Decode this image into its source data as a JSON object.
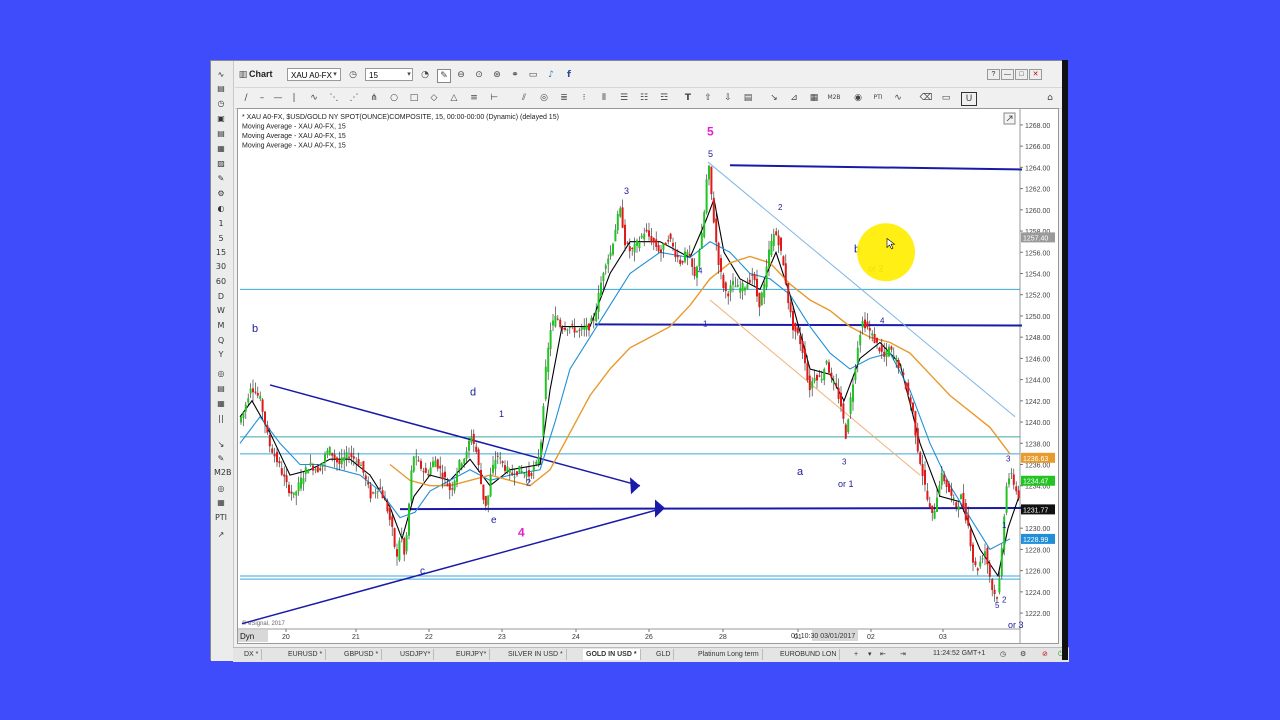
{
  "window": {
    "title": "Chart",
    "symbol": "XAU A0-FX",
    "interval": "15",
    "winbuttons": [
      "?",
      "—",
      "□",
      "✕"
    ]
  },
  "left_tools": [
    "∿",
    "▤",
    "◷",
    "▣",
    "▤",
    "▦",
    "▨",
    "✎",
    "⚙",
    "◐",
    "1",
    "5",
    "15",
    "30",
    "60",
    "D",
    "W",
    "M",
    "Q",
    "Y",
    "◎",
    "▤",
    "▦",
    "||",
    "↘",
    "✎",
    "M2B",
    "◎",
    "▦",
    "PTI",
    "↗"
  ],
  "chart_info": {
    "line1": "* XAU A0-FX, $USD/GOLD NY SPOT(OUNCE)COMPOSITE, 15, 00:00-00:00 (Dynamic) (delayed 15)",
    "line2": "Moving Average - XAU A0-FX, 15",
    "line3": "Moving Average - XAU A0-FX, 15",
    "line4": "Moving Average - XAU A0-FX, 15",
    "copyright": "© eSignal, 2017",
    "dyn": "Dyn",
    "cursor_date": "01 10:30 03/01/2017"
  },
  "colors": {
    "background": "#3f4cfb",
    "price_up": "#22c322",
    "price_down": "#e01a1a",
    "ma_fast": "#000000",
    "ma_mid": "#1f8fd8",
    "ma_slow": "#e89a2c",
    "drawn_lines": "#1a1aaa",
    "wave_label": "#1a1a9c",
    "magenta": "#e020d0",
    "highlight": "#ffee00"
  },
  "chart_data": {
    "type": "candlestick",
    "x_tick_labels": [
      "20",
      "21",
      "22",
      "23",
      "24",
      "26",
      "28",
      "01",
      "02",
      "03"
    ],
    "y_ticks": [
      1222,
      1224,
      1226,
      1228,
      1230,
      1232,
      1234,
      1236,
      1238,
      1240,
      1242,
      1244,
      1246,
      1248,
      1250,
      1252,
      1254,
      1256,
      1258,
      1260,
      1262,
      1264,
      1266,
      1268
    ],
    "ylim": [
      1220.5,
      1269.5
    ],
    "price_tags": [
      {
        "value": 1257.4,
        "label": "1257.40",
        "color": "#9a9a9a"
      },
      {
        "value": 1236.63,
        "label": "1236.63",
        "color": "#e89a2c"
      },
      {
        "value": 1234.47,
        "label": "1234.47",
        "color": "#22c322"
      },
      {
        "value": 1231.77,
        "label": "1231.77",
        "color": "#111111"
      },
      {
        "value": 1228.99,
        "label": "1228.99",
        "color": "#1f8fd8"
      }
    ],
    "price_path": [
      [
        0,
        1240
      ],
      [
        5,
        1241
      ],
      [
        12,
        1243.5
      ],
      [
        22,
        1242
      ],
      [
        30,
        1238
      ],
      [
        40,
        1236
      ],
      [
        48,
        1234
      ],
      [
        55,
        1233
      ],
      [
        62,
        1234.5
      ],
      [
        70,
        1236
      ],
      [
        80,
        1235.5
      ],
      [
        90,
        1237.5
      ],
      [
        100,
        1236
      ],
      [
        110,
        1237
      ],
      [
        122,
        1236
      ],
      [
        132,
        1233
      ],
      [
        140,
        1234
      ],
      [
        148,
        1232
      ],
      [
        153,
        1230
      ],
      [
        158,
        1227
      ],
      [
        162,
        1230
      ],
      [
        166,
        1227
      ],
      [
        170,
        1232
      ],
      [
        174,
        1237
      ],
      [
        180,
        1236
      ],
      [
        188,
        1235
      ],
      [
        196,
        1236.5
      ],
      [
        204,
        1235
      ],
      [
        212,
        1233.5
      ],
      [
        220,
        1236
      ],
      [
        228,
        1237
      ],
      [
        232,
        1239
      ],
      [
        238,
        1237
      ],
      [
        244,
        1233
      ],
      [
        248,
        1232
      ],
      [
        252,
        1235
      ],
      [
        258,
        1237
      ],
      [
        264,
        1236
      ],
      [
        272,
        1235
      ],
      [
        280,
        1235.5
      ],
      [
        290,
        1235
      ],
      [
        298,
        1236
      ],
      [
        302,
        1238
      ],
      [
        306,
        1244
      ],
      [
        312,
        1249
      ],
      [
        318,
        1250
      ],
      [
        322,
        1249
      ],
      [
        330,
        1249
      ],
      [
        340,
        1248.5
      ],
      [
        350,
        1249
      ],
      [
        356,
        1250
      ],
      [
        360,
        1252
      ],
      [
        366,
        1255
      ],
      [
        372,
        1256
      ],
      [
        378,
        1259
      ],
      [
        382,
        1260
      ],
      [
        386,
        1257
      ],
      [
        392,
        1256
      ],
      [
        400,
        1257
      ],
      [
        406,
        1258
      ],
      [
        414,
        1257
      ],
      [
        422,
        1256
      ],
      [
        430,
        1257.5
      ],
      [
        436,
        1256
      ],
      [
        442,
        1255
      ],
      [
        448,
        1256
      ],
      [
        452,
        1255
      ],
      [
        456,
        1253.5
      ],
      [
        460,
        1256
      ],
      [
        464,
        1258
      ],
      [
        468,
        1263
      ],
      [
        470,
        1264
      ],
      [
        472,
        1262
      ],
      [
        476,
        1258
      ],
      [
        480,
        1255
      ],
      [
        484,
        1253
      ],
      [
        488,
        1252
      ],
      [
        494,
        1253
      ],
      [
        500,
        1252.5
      ],
      [
        508,
        1253
      ],
      [
        514,
        1254
      ],
      [
        520,
        1251
      ],
      [
        526,
        1253
      ],
      [
        530,
        1256
      ],
      [
        536,
        1258
      ],
      [
        540,
        1257
      ],
      [
        546,
        1254
      ],
      [
        550,
        1251
      ],
      [
        554,
        1249
      ],
      [
        560,
        1248
      ],
      [
        566,
        1246
      ],
      [
        570,
        1243
      ],
      [
        576,
        1244.5
      ],
      [
        582,
        1244
      ],
      [
        588,
        1246
      ],
      [
        592,
        1244
      ],
      [
        598,
        1243
      ],
      [
        604,
        1241
      ],
      [
        606,
        1238
      ],
      [
        610,
        1241
      ],
      [
        616,
        1245
      ],
      [
        620,
        1248
      ],
      [
        624,
        1249.5
      ],
      [
        628,
        1249
      ],
      [
        634,
        1248
      ],
      [
        640,
        1247
      ],
      [
        646,
        1246
      ],
      [
        650,
        1247
      ],
      [
        656,
        1246
      ],
      [
        662,
        1245
      ],
      [
        668,
        1243
      ],
      [
        674,
        1241
      ],
      [
        678,
        1238
      ],
      [
        682,
        1236
      ],
      [
        686,
        1234
      ],
      [
        690,
        1232
      ],
      [
        694,
        1231
      ],
      [
        698,
        1233
      ],
      [
        702,
        1235
      ],
      [
        706,
        1234.5
      ],
      [
        712,
        1233
      ],
      [
        718,
        1232
      ],
      [
        722,
        1233
      ],
      [
        726,
        1231.5
      ],
      [
        730,
        1230
      ],
      [
        734,
        1227
      ],
      [
        738,
        1226
      ],
      [
        742,
        1227
      ],
      [
        746,
        1228
      ],
      [
        750,
        1226
      ],
      [
        754,
        1224
      ],
      [
        758,
        1223.5
      ],
      [
        762,
        1226
      ],
      [
        764,
        1230
      ],
      [
        766,
        1232
      ],
      [
        768,
        1234.5
      ],
      [
        772,
        1235
      ],
      [
        776,
        1234
      ],
      [
        779,
        1233
      ]
    ],
    "moving_averages": [
      {
        "name": "Moving Average - XAU A0-FX, 15",
        "color": "#000000",
        "points": [
          [
            0,
            1240.5
          ],
          [
            12,
            1242
          ],
          [
            30,
            1239
          ],
          [
            50,
            1235
          ],
          [
            70,
            1235.5
          ],
          [
            90,
            1236.5
          ],
          [
            110,
            1236.5
          ],
          [
            130,
            1235
          ],
          [
            150,
            1232
          ],
          [
            162,
            1229
          ],
          [
            174,
            1233
          ],
          [
            190,
            1235
          ],
          [
            210,
            1234.5
          ],
          [
            230,
            1236.5
          ],
          [
            250,
            1234
          ],
          [
            270,
            1235.5
          ],
          [
            300,
            1236
          ],
          [
            310,
            1243
          ],
          [
            322,
            1249
          ],
          [
            350,
            1249
          ],
          [
            370,
            1254
          ],
          [
            390,
            1257
          ],
          [
            420,
            1257
          ],
          [
            450,
            1255.5
          ],
          [
            466,
            1259
          ],
          [
            474,
            1261
          ],
          [
            484,
            1256
          ],
          [
            500,
            1253.5
          ],
          [
            520,
            1252.5
          ],
          [
            536,
            1256
          ],
          [
            550,
            1252
          ],
          [
            570,
            1245
          ],
          [
            590,
            1244.5
          ],
          [
            604,
            1242
          ],
          [
            620,
            1246
          ],
          [
            640,
            1247.5
          ],
          [
            660,
            1245.5
          ],
          [
            680,
            1238
          ],
          [
            700,
            1233
          ],
          [
            720,
            1232.5
          ],
          [
            740,
            1228
          ],
          [
            758,
            1225.5
          ],
          [
            768,
            1230
          ],
          [
            779,
            1233
          ]
        ]
      },
      {
        "name": "Moving Average - XAU A0-FX, 15",
        "color": "#1f8fd8",
        "points": [
          [
            0,
            1238
          ],
          [
            20,
            1240.5
          ],
          [
            40,
            1238
          ],
          [
            60,
            1236
          ],
          [
            80,
            1236
          ],
          [
            100,
            1235.5
          ],
          [
            120,
            1235
          ],
          [
            140,
            1233.5
          ],
          [
            160,
            1231
          ],
          [
            175,
            1231.5
          ],
          [
            190,
            1233.5
          ],
          [
            210,
            1234.5
          ],
          [
            230,
            1235.5
          ],
          [
            250,
            1234.5
          ],
          [
            270,
            1235
          ],
          [
            300,
            1235.5
          ],
          [
            315,
            1240
          ],
          [
            330,
            1245
          ],
          [
            350,
            1248
          ],
          [
            370,
            1251
          ],
          [
            390,
            1254
          ],
          [
            420,
            1256
          ],
          [
            450,
            1255.5
          ],
          [
            470,
            1257
          ],
          [
            490,
            1256
          ],
          [
            510,
            1254
          ],
          [
            530,
            1253.5
          ],
          [
            550,
            1252
          ],
          [
            570,
            1249
          ],
          [
            590,
            1246.5
          ],
          [
            610,
            1245
          ],
          [
            630,
            1246
          ],
          [
            650,
            1246.5
          ],
          [
            670,
            1243
          ],
          [
            690,
            1238
          ],
          [
            710,
            1234
          ],
          [
            730,
            1231
          ],
          [
            750,
            1228
          ],
          [
            770,
            1229
          ]
        ]
      },
      {
        "name": "Moving Average - XAU A0-FX, 15",
        "color": "#e89a2c",
        "points": [
          [
            150,
            1236
          ],
          [
            170,
            1234.5
          ],
          [
            190,
            1234
          ],
          [
            210,
            1234
          ],
          [
            230,
            1234.5
          ],
          [
            250,
            1235
          ],
          [
            270,
            1234.5
          ],
          [
            290,
            1234
          ],
          [
            310,
            1235.5
          ],
          [
            330,
            1239
          ],
          [
            350,
            1242.5
          ],
          [
            370,
            1245
          ],
          [
            390,
            1247
          ],
          [
            410,
            1248
          ],
          [
            430,
            1249
          ],
          [
            450,
            1251
          ],
          [
            470,
            1253.5
          ],
          [
            490,
            1255
          ],
          [
            510,
            1255.6
          ],
          [
            530,
            1255
          ],
          [
            550,
            1253
          ],
          [
            570,
            1251.5
          ],
          [
            590,
            1250.5
          ],
          [
            610,
            1249
          ],
          [
            630,
            1248
          ],
          [
            650,
            1247.5
          ],
          [
            670,
            1246.5
          ],
          [
            690,
            1244.5
          ],
          [
            710,
            1242.5
          ],
          [
            730,
            1241
          ],
          [
            750,
            1239.5
          ],
          [
            770,
            1237
          ]
        ]
      }
    ],
    "annotations": [
      {
        "text": "5",
        "x": 467,
        "v": 1267,
        "color": "#e020d0",
        "size": 12
      },
      {
        "text": "5",
        "x": 468,
        "v": 1265,
        "color": "#1a1a9c",
        "size": 9
      },
      {
        "text": "3",
        "x": 384,
        "v": 1261.5,
        "color": "#1a1a9c",
        "size": 9
      },
      {
        "text": "2",
        "x": 538,
        "v": 1260,
        "color": "#1a1a9c",
        "size": 8
      },
      {
        "text": "b",
        "x": 614,
        "v": 1256,
        "color": "#1a1a9c",
        "size": 11
      },
      {
        "text": "or 2",
        "x": 628,
        "v": 1254.2,
        "color": "#1a1a9c",
        "size": 9
      },
      {
        "text": "b",
        "x": 12,
        "v": 1248.5,
        "color": "#1a1a9c",
        "size": 11
      },
      {
        "text": "d",
        "x": 230,
        "v": 1242.5,
        "color": "#1a1a9c",
        "size": 11
      },
      {
        "text": "1",
        "x": 259,
        "v": 1240.5,
        "color": "#1a1a9c",
        "size": 9
      },
      {
        "text": "4",
        "x": 458,
        "v": 1254,
        "color": "#1a1a9c",
        "size": 8
      },
      {
        "text": "1",
        "x": 463,
        "v": 1249,
        "color": "#1a1a9c",
        "size": 8
      },
      {
        "text": "4",
        "x": 640,
        "v": 1249.3,
        "color": "#1a1a9c",
        "size": 8
      },
      {
        "text": "2",
        "x": 286,
        "v": 1234,
        "color": "#1a1a9c",
        "size": 9
      },
      {
        "text": "e",
        "x": 251,
        "v": 1230.5,
        "color": "#1a1a9c",
        "size": 10
      },
      {
        "text": "4",
        "x": 278,
        "v": 1229.2,
        "color": "#e020d0",
        "size": 12
      },
      {
        "text": "c",
        "x": 180,
        "v": 1225.7,
        "color": "#1a1a9c",
        "size": 10
      },
      {
        "text": "3",
        "x": 602,
        "v": 1236,
        "color": "#1a1a9c",
        "size": 8
      },
      {
        "text": "a",
        "x": 557,
        "v": 1235,
        "color": "#1a1a9c",
        "size": 11
      },
      {
        "text": "or 1",
        "x": 598,
        "v": 1233.9,
        "color": "#1a1a9c",
        "size": 9
      },
      {
        "text": "3",
        "x": 766,
        "v": 1236.3,
        "color": "#1a1a9c",
        "size": 8
      },
      {
        "text": "1",
        "x": 762,
        "v": 1230,
        "color": "#1a1a9c",
        "size": 8
      },
      {
        "text": "5",
        "x": 755,
        "v": 1222.5,
        "color": "#1a1a9c",
        "size": 8
      },
      {
        "text": "2",
        "x": 762,
        "v": 1223,
        "color": "#1a1a9c",
        "size": 8
      },
      {
        "text": "or 3",
        "x": 768,
        "v": 1220.6,
        "color": "#1a1a9c",
        "size": 9
      }
    ]
  },
  "tabs": [
    "DX *",
    "EURUSD *",
    "GBPUSD *",
    "USDJPY*",
    "EURJPY*",
    "SILVER IN USD *",
    "GOLD IN USD *",
    "GLD",
    "Platinum Long term",
    "EUROBUND LON"
  ],
  "active_tab": "GOLD IN USD *",
  "clock": "11:24:52 GMT+1"
}
